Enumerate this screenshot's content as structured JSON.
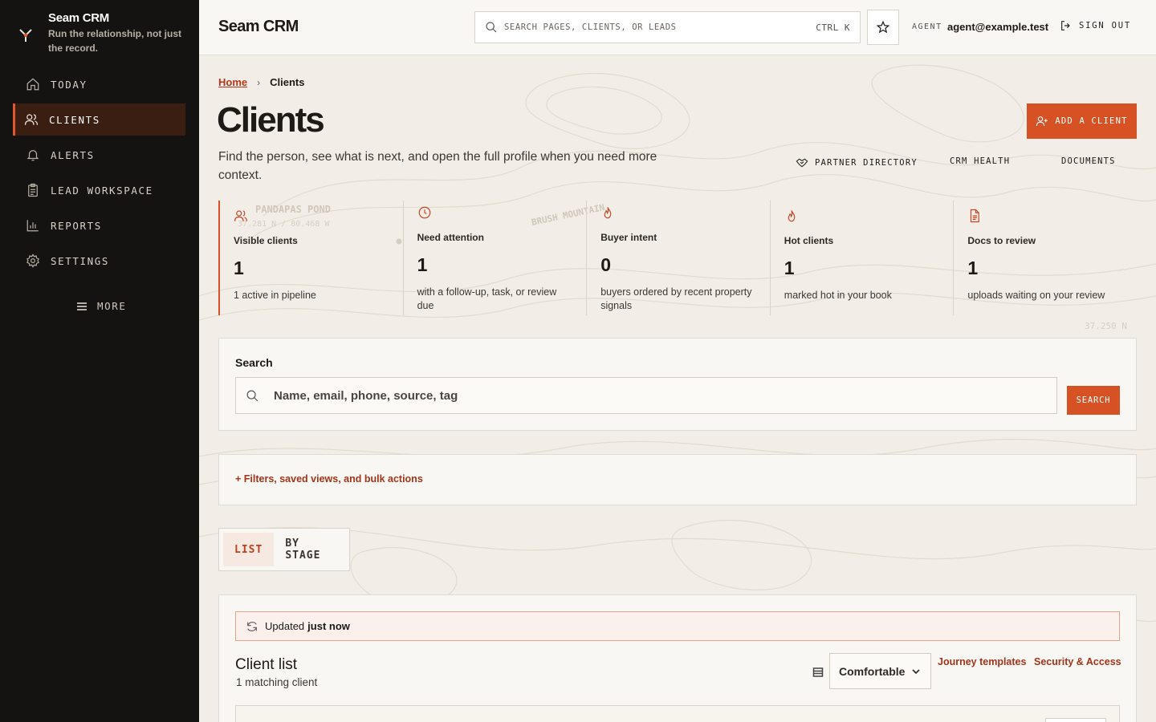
{
  "app": {
    "brand_name": "Seam CRM",
    "tagline": "Run the relationship, not just the record."
  },
  "sidebar": {
    "items": [
      {
        "label": "TODAY",
        "icon": "home-icon",
        "active": false
      },
      {
        "label": "CLIENTS",
        "icon": "users-icon",
        "active": true
      },
      {
        "label": "ALERTS",
        "icon": "bell-icon",
        "active": false
      },
      {
        "label": "LEAD WORKSPACE",
        "icon": "clipboard-icon",
        "active": false
      },
      {
        "label": "REPORTS",
        "icon": "bar-chart-icon",
        "active": false
      },
      {
        "label": "SETTINGS",
        "icon": "gear-icon",
        "active": false
      }
    ],
    "more_label": "MORE"
  },
  "topbar": {
    "title": "Seam CRM",
    "search_placeholder": "SEARCH PAGES, CLIENTS, OR LEADS",
    "shortcut": "CTRL K",
    "agent_label": "AGENT",
    "agent_email": "agent@example.test",
    "signout_label": "SIGN OUT"
  },
  "breadcrumb": {
    "home": "Home",
    "current": "Clients"
  },
  "page": {
    "title": "Clients",
    "description": "Find the person, see what is next, and open the full profile when you need more context.",
    "add_button": "ADD A CLIENT",
    "links": [
      "PARTNER DIRECTORY",
      "CRM HEALTH",
      "DOCUMENTS"
    ]
  },
  "map_labels": {
    "place1": "PANDAPAS POND",
    "coord1": "37.281 N / 80.468 W",
    "place2": "BRUSH MOUNTAIN",
    "coord2": "37.250 N"
  },
  "stats": [
    {
      "label": "Visible clients",
      "value": "1",
      "sub": "1 active in pipeline",
      "icon": "users-icon"
    },
    {
      "label": "Need attention",
      "value": "1",
      "sub": "with a follow-up, task, or review due",
      "icon": "clock-icon"
    },
    {
      "label": "Buyer intent",
      "value": "0",
      "sub": "buyers ordered by recent property signals",
      "icon": "flame-icon"
    },
    {
      "label": "Hot clients",
      "value": "1",
      "sub": "marked hot in your book",
      "icon": "flame-icon"
    },
    {
      "label": "Docs to review",
      "value": "1",
      "sub": "uploads waiting on your review",
      "icon": "document-icon"
    }
  ],
  "search": {
    "label": "Search",
    "placeholder": "Name, email, phone, source, tag",
    "button": "SEARCH"
  },
  "filters": {
    "label": "+ Filters, saved views, and bulk actions"
  },
  "view_tabs": [
    {
      "label": "LIST",
      "active": true
    },
    {
      "label": "BY STAGE",
      "active": false
    }
  ],
  "client_list": {
    "updated_prefix": "Updated",
    "updated_value": "just now",
    "title": "Client list",
    "count": "1 matching client",
    "density": "Comfortable",
    "link_journey": "Journey templates",
    "link_security": "Security & Access"
  },
  "colors": {
    "accent": "#d65224",
    "sidebar_bg": "#151311",
    "link": "#a3341a"
  }
}
